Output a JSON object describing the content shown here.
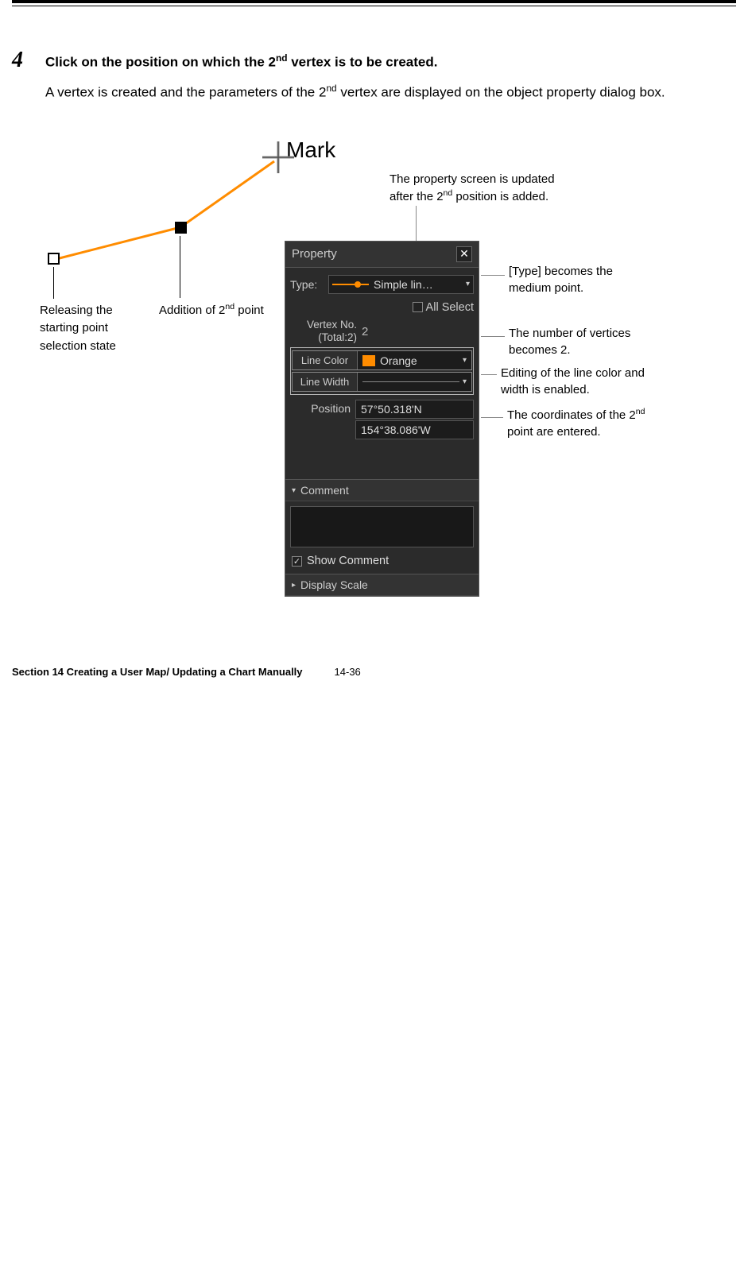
{
  "step": {
    "number": "4",
    "title_prefix": "Click on the position on which the 2",
    "title_sup": "nd",
    "title_suffix": " vertex is to be created.",
    "body_prefix": "A vertex is created and the parameters of the 2",
    "body_sup": "nd",
    "body_suffix": " vertex are displayed on the object property dialog box."
  },
  "diagram": {
    "mark_label": "Mark",
    "releasing_label": "Releasing the starting point selection state",
    "addition_prefix": "Addition of 2",
    "addition_sup": "nd",
    "addition_suffix": " point"
  },
  "panel": {
    "title": "Property",
    "type_label": "Type:",
    "type_value": "Simple lin…",
    "all_select": "All Select",
    "vertex_no_label": "Vertex No.",
    "vertex_total_label": "(Total:2)",
    "vertex_value": "2",
    "line_color_label": "Line Color",
    "line_color_value": "Orange",
    "line_width_label": "Line Width",
    "position_label": "Position",
    "position_lat": "57°50.318'N",
    "position_lon": "154°38.086'W",
    "comment_header": "Comment",
    "show_comment": "Show Comment",
    "display_scale": "Display Scale"
  },
  "annotations": {
    "top_prefix": "The property screen is updated after the 2",
    "top_sup": "nd",
    "top_suffix": " position is added.",
    "type": "[Type] becomes the medium point.",
    "vertices": "The number of vertices becomes 2.",
    "color": "Editing of the line color and width is enabled.",
    "coords_prefix": "The coordinates of the 2",
    "coords_sup": "nd",
    "coords_suffix": " point are entered."
  },
  "footer": {
    "section": "Section 14    Creating a User Map/ Updating a Chart Manually",
    "page": "14-36"
  }
}
